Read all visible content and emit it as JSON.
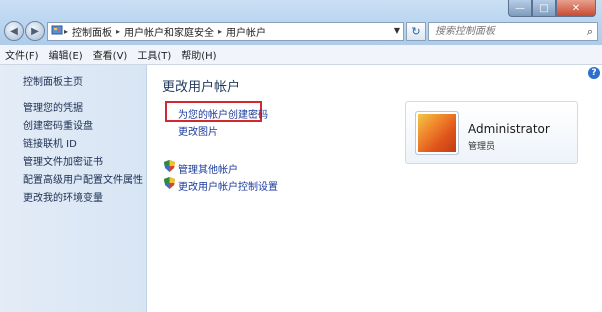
{
  "window": {
    "min_glyph": "—",
    "max_glyph": "□",
    "close_glyph": "✕"
  },
  "address": {
    "breadcrumb": [
      "控制面板",
      "用户帐户和家庭安全",
      "用户帐户"
    ]
  },
  "search": {
    "placeholder": "搜索控制面板"
  },
  "menu": [
    "文件(F)",
    "编辑(E)",
    "查看(V)",
    "工具(T)",
    "帮助(H)"
  ],
  "sidebar": {
    "items": [
      "控制面板主页",
      "管理您的凭据",
      "创建密码重设盘",
      "链接联机 ID",
      "管理文件加密证书",
      "配置高级用户配置文件属性",
      "更改我的环境变量"
    ]
  },
  "main": {
    "title": "更改用户帐户",
    "links": {
      "create_password": "为您的帐户创建密码",
      "change_picture": "更改图片",
      "manage_other": "管理其他帐户",
      "uac_settings": "更改用户帐户控制设置"
    },
    "help_glyph": "?"
  },
  "account": {
    "name": "Administrator",
    "role": "管理员"
  },
  "colors": {
    "accent": "#1a3b9c",
    "highlight_border": "#d2292d"
  }
}
